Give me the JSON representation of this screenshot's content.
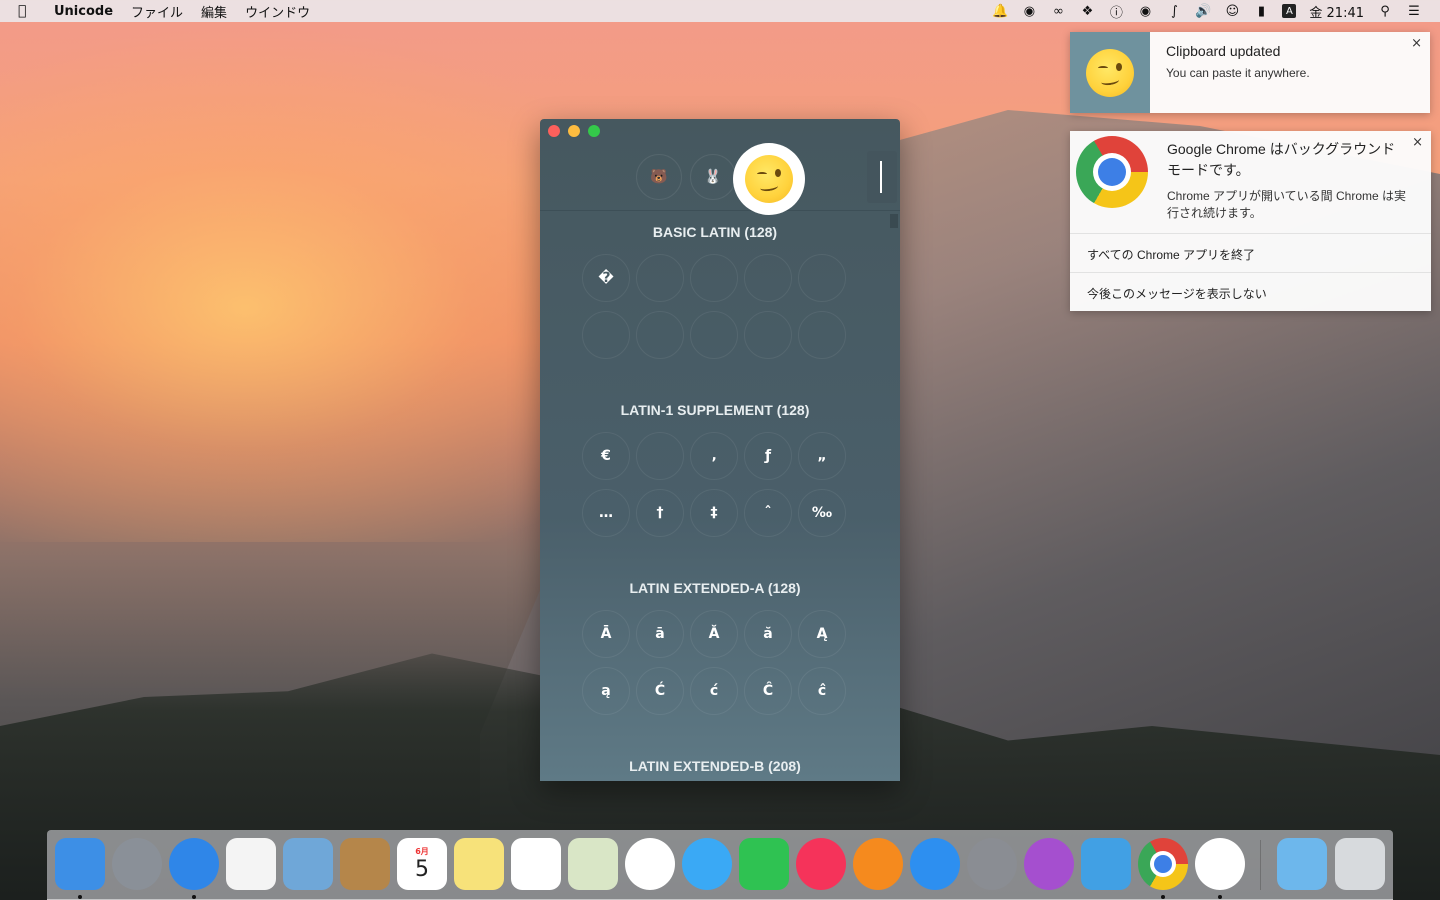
{
  "menubar": {
    "apple_icon": "apple-logo-icon",
    "app_name": "Unicode",
    "menus": [
      "ファイル",
      "編集",
      "ウインドウ"
    ],
    "clock": "金 21:41",
    "input_source": "A",
    "status_icons": [
      "notification-bell-icon",
      "airplay-icon",
      "glasses-icon",
      "dropbox-icon",
      "app-1-icon",
      "app-2-icon",
      "bluetooth-icon",
      "volume-icon",
      "wifi-icon",
      "battery-icon",
      "input-source-icon",
      "clock",
      "spotlight-icon",
      "notification-center-icon"
    ]
  },
  "unicode_window": {
    "tabs": [
      {
        "icon": "bear-emoji-icon"
      },
      {
        "icon": "rabbit-emoji-icon"
      },
      {
        "icon": "winking-face-icon",
        "active": true
      }
    ],
    "sections": [
      {
        "title": "BASIC LATIN (128)",
        "rows": [
          [
            "�",
            "",
            "",
            "",
            ""
          ],
          [
            "",
            "",
            "",
            "",
            ""
          ]
        ]
      },
      {
        "title": "LATIN-1 SUPPLEMENT (128)",
        "rows": [
          [
            "€",
            "",
            "‚",
            "ƒ",
            "„"
          ],
          [
            "…",
            "†",
            "‡",
            "ˆ",
            "‰"
          ]
        ]
      },
      {
        "title": "LATIN EXTENDED-A (128)",
        "rows": [
          [
            "Ā",
            "ā",
            "Ă",
            "ă",
            "Ą"
          ],
          [
            "ą",
            "Ć",
            "ć",
            "Ĉ",
            "ĉ"
          ]
        ]
      },
      {
        "title": "LATIN EXTENDED-B (208)",
        "rows": []
      }
    ]
  },
  "notifications": {
    "clipboard": {
      "title": "Clipboard updated",
      "body": "You can paste it anywhere.",
      "close": "×"
    },
    "chrome": {
      "title": "Google Chrome はバックグラウンドモードです。",
      "body": "Chrome アプリが開いている間 Chrome は実行され続けます。",
      "close": "×",
      "actions": [
        "すべての Chrome アプリを終了",
        "今後このメッセージを表示しない"
      ]
    }
  },
  "dock": {
    "items": [
      {
        "name": "finder",
        "color": "#3d8fe6",
        "running": true
      },
      {
        "name": "launchpad",
        "color": "#8a9098",
        "running": false
      },
      {
        "name": "safari",
        "color": "#2f86e8",
        "running": true
      },
      {
        "name": "photo-booth-grid",
        "color": "#f4f4f4",
        "running": false
      },
      {
        "name": "mail",
        "color": "#6fa7d8",
        "running": false
      },
      {
        "name": "contacts",
        "color": "#b5864a",
        "running": false
      },
      {
        "name": "calendar",
        "color": "#ffffff",
        "running": false,
        "label": "5",
        "sublabel": "6月"
      },
      {
        "name": "notes",
        "color": "#f7e27a",
        "running": false
      },
      {
        "name": "reminders",
        "color": "#ffffff",
        "running": false
      },
      {
        "name": "photos-viewer",
        "color": "#d9e6c6",
        "running": false
      },
      {
        "name": "photos",
        "color": "#ffffff",
        "running": false
      },
      {
        "name": "messages",
        "color": "#3aa9f5",
        "running": false
      },
      {
        "name": "facetime",
        "color": "#2fc252",
        "running": false
      },
      {
        "name": "itunes",
        "color": "#f5335a",
        "running": false
      },
      {
        "name": "ibooks",
        "color": "#f58a1e",
        "running": false
      },
      {
        "name": "app-store",
        "color": "#2d8ff0",
        "running": false
      },
      {
        "name": "system-preferences",
        "color": "#8a8d93",
        "running": false
      },
      {
        "name": "instastats",
        "color": "#a54fcf",
        "running": false
      },
      {
        "name": "tweetbot",
        "color": "#41a0e4",
        "running": false
      },
      {
        "name": "chrome",
        "color": "#ffffff",
        "running": true
      },
      {
        "name": "unicode-app",
        "color": "#ffffff",
        "running": true
      },
      {
        "name": "downloads-folder",
        "color": "#6db7ec",
        "running": false
      },
      {
        "name": "trash",
        "color": "#d7dadd",
        "running": false
      }
    ]
  }
}
